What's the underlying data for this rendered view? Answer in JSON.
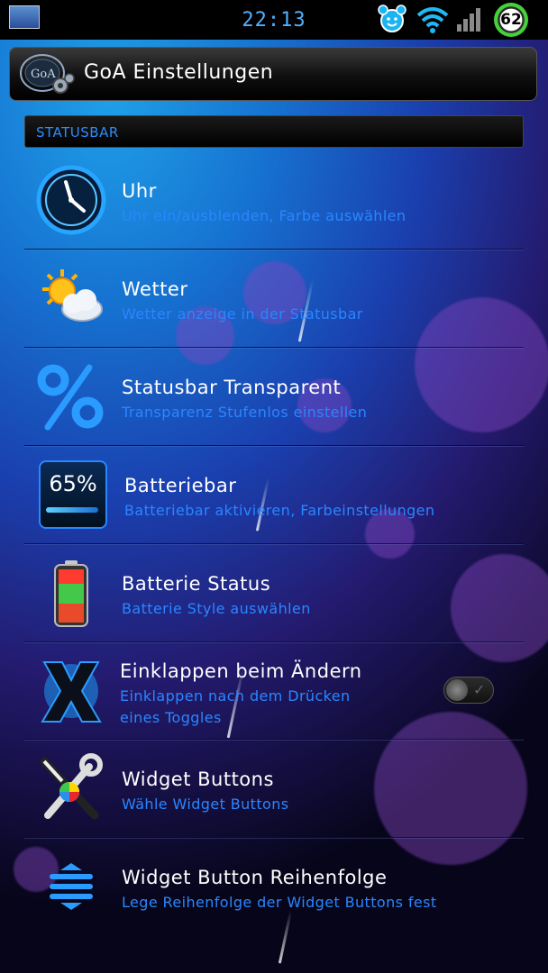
{
  "status_bar": {
    "time": "22:13",
    "battery_level": "62",
    "icons": [
      "screenshot-thumbnail-icon",
      "alarm-clock-icon",
      "wifi-icon",
      "signal-icon",
      "battery-icon"
    ]
  },
  "header": {
    "logo_text": "GoA",
    "title": "GoA Einstellungen"
  },
  "section": {
    "title": "STATUSBAR"
  },
  "items": [
    {
      "title": "Uhr",
      "subtitle": "Uhr ein/ausblenden, Farbe auswählen",
      "icon": "clock-icon"
    },
    {
      "title": "Wetter",
      "subtitle": "Wetter anzeige in der Statusbar",
      "icon": "weather-icon"
    },
    {
      "title": "Statusbar Transparent",
      "subtitle": "Transparenz Stufenlos einstellen",
      "icon": "percent-icon"
    },
    {
      "title": "Batteriebar",
      "subtitle": "Batteriebar aktivieren, Farbeinstellungen",
      "icon": "battery-percent-icon",
      "icon_text": "65%"
    },
    {
      "title": "Batterie Status",
      "subtitle": "Batterie Style auswählen",
      "icon": "battery-status-icon"
    },
    {
      "title": "Einklappen beim Ändern",
      "subtitle_line1": "Einklappen nach dem Drücken",
      "subtitle_line2": "eines Toggles",
      "icon": "x-icon",
      "toggle": "off"
    },
    {
      "title": "Widget Buttons",
      "subtitle": "Wähle Widget Buttons",
      "icon": "tools-icon"
    },
    {
      "title": "Widget Button Reihenfolge",
      "subtitle": "Lege Reihenfolge der Widget Buttons fest",
      "icon": "reorder-icon"
    }
  ],
  "colors": {
    "accent": "#2a86ff",
    "title_text": "#ffffff",
    "status_time": "#4fb1ff",
    "battery_ring": "#45d13a"
  }
}
